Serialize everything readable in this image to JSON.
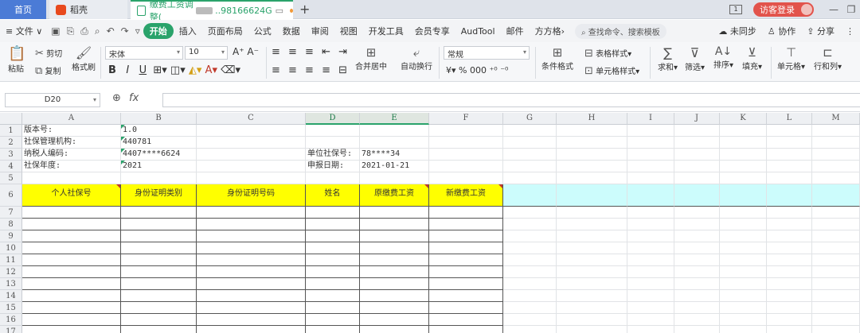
{
  "titlebar": {
    "tabs": [
      {
        "label": "首页"
      },
      {
        "label": "稻壳"
      },
      {
        "label_prefix": "缴费工资调整(",
        "label_suffix": "..98166624G"
      }
    ],
    "new_tab": "+",
    "box_icon_text": "1",
    "visitor_login": "访客登录",
    "minimize": "—",
    "restore": "❐"
  },
  "menubar": {
    "file": "≡ 文件 ∨",
    "start": "开始",
    "items": [
      "插入",
      "页面布局",
      "公式",
      "数据",
      "审阅",
      "视图",
      "开发工具",
      "会员专享",
      "AudTool",
      "邮件",
      "方方格›"
    ],
    "search": "查找命令、搜索模板",
    "right": [
      "未同步",
      "协作",
      "分享"
    ]
  },
  "ribbon": {
    "paste": "粘贴",
    "cut": "剪切",
    "copy": "复制",
    "format_painter": "格式刷",
    "font": "宋体",
    "font_size": "10",
    "bold": "B",
    "italic": "I",
    "underline": "U",
    "merge_center": "合并居中",
    "wrap": "自动换行",
    "number_format": "常规",
    "conditional": "条件格式",
    "table_style": "表格样式",
    "cell_style": "单元格样式",
    "sum": "求和",
    "filter": "筛选",
    "sort": "排序",
    "fill": "填充",
    "cell": "单元格",
    "rowcol": "行和列",
    "currency": "¥",
    "percent": "%",
    "thousands": "000"
  },
  "formula_bar": {
    "cell_ref": "D20",
    "fx": "fx",
    "value": ""
  },
  "sheet": {
    "columns": [
      "A",
      "B",
      "C",
      "D",
      "E",
      "F",
      "G",
      "H",
      "I",
      "J",
      "K",
      "L",
      "M"
    ],
    "selected_columns": [
      "D",
      "E"
    ],
    "rows": [
      "1",
      "2",
      "3",
      "4",
      "5",
      "6",
      "7",
      "8",
      "9",
      "10",
      "11",
      "12",
      "13",
      "14",
      "15",
      "16",
      "17"
    ],
    "cells": {
      "A1": "版本号:",
      "B1": "1.0",
      "A2": "社保管理机构:",
      "B2": "440781",
      "A3": "纳税人编码:",
      "B3": "4407****6624",
      "D3": "单位社保号:",
      "E3": "78****34",
      "A4": "社保年度:",
      "B4": "2021",
      "D4": "申报日期:",
      "E4": "2021-01-21"
    },
    "header_row": [
      "个人社保号",
      "身份证明类别",
      "身份证明号码",
      "姓名",
      "原缴费工资",
      "新缴费工资"
    ],
    "header_color": "#ffff00",
    "extra_header_color": "#ccfcfc"
  }
}
